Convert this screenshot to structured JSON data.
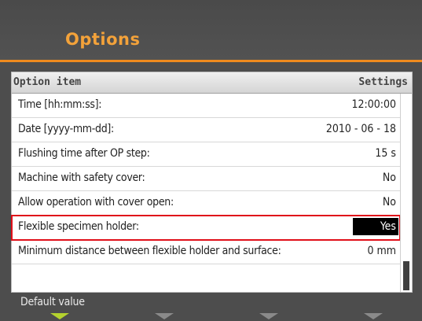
{
  "header": {
    "title": "Options"
  },
  "table": {
    "col_item": "Option item",
    "col_settings": "Settings",
    "rows": [
      {
        "label": "Time [hh:mm:ss]:",
        "value": "12:00:00"
      },
      {
        "label": "Date [yyyy-mm-dd]:",
        "value": "2010 - 06 - 18"
      },
      {
        "label": "Flushing time after OP step:",
        "value": "15 s"
      },
      {
        "label": "Machine with safety cover:",
        "value": "No"
      },
      {
        "label": "Allow operation with cover open:",
        "value": "No"
      },
      {
        "label": "Flexible specimen holder:",
        "value": "Yes"
      },
      {
        "label": "Minimum distance between flexible holder and surface:",
        "value": "0 mm"
      }
    ],
    "selected_index": 5
  },
  "footer": {
    "label": "Default value",
    "softkeys": [
      "softkey-1",
      "softkey-2",
      "softkey-3",
      "softkey-4"
    ]
  },
  "colors": {
    "accent": "#ef8a1e",
    "selection_outline": "#e0101a",
    "softkey_active": "#b4d22e"
  }
}
